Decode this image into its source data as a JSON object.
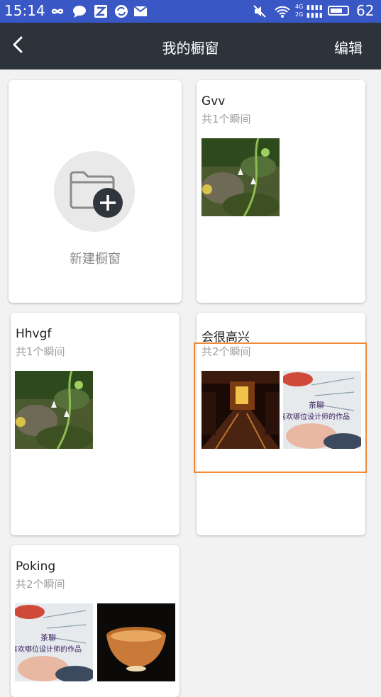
{
  "status_bar": {
    "time": "15:14",
    "battery": "62",
    "left_icons": [
      "infinity-icon",
      "chat-bubble-icon",
      "z-app-icon",
      "sync-icon",
      "mail-icon"
    ],
    "right_icons": [
      "mute-icon",
      "wifi-icon",
      "signal-4g-icon",
      "signal-2g-icon",
      "battery-icon"
    ]
  },
  "nav": {
    "title": "我的橱窗",
    "edit_label": "编辑"
  },
  "new_window": {
    "label": "新建橱窗"
  },
  "windows": [
    {
      "name": "Gvv",
      "count": "共1个瞬间",
      "thumbnails": [
        "moss-stones-photo"
      ]
    },
    {
      "name": "Hhvgf",
      "count": "共1个瞬间",
      "thumbnails": [
        "moss-stones-photo"
      ]
    },
    {
      "name": "会很高兴",
      "count": "共2个瞬间",
      "thumbnails": [
        "dark-room-photo",
        "designer-sketch-photo"
      ]
    },
    {
      "name": "Poking",
      "count": "共2个瞬间",
      "thumbnails": [
        "designer-sketch-photo",
        "tea-cup-photo"
      ]
    }
  ],
  "sketch_text": {
    "line1": "茶聊",
    "line2": "喜欢哪位设计师的作品"
  },
  "colors": {
    "status_bar": "#3a57c6",
    "nav_bar": "#2d333b",
    "highlight": "#ee8a3a"
  }
}
